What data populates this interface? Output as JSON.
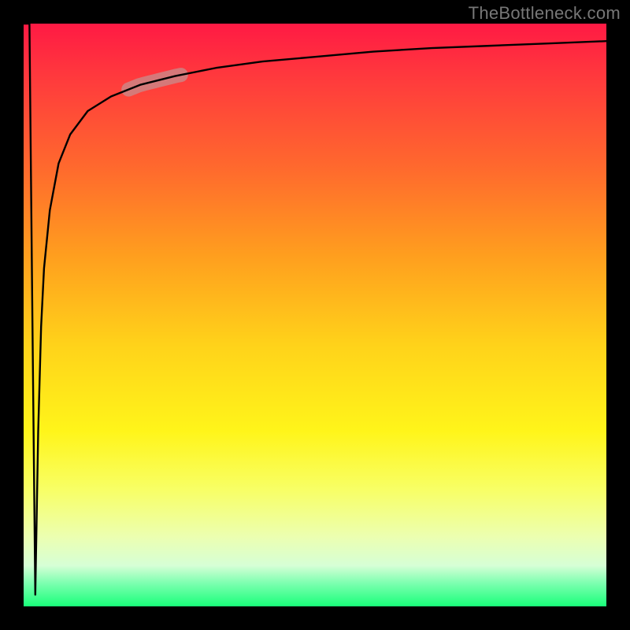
{
  "watermark": "TheBottleneck.com",
  "chart_data": {
    "type": "line",
    "title": "",
    "xlabel": "",
    "ylabel": "",
    "ylim": [
      0,
      100
    ],
    "x": [
      0.0,
      0.01,
      0.015,
      0.02,
      0.025,
      0.03,
      0.035,
      0.045,
      0.06,
      0.08,
      0.11,
      0.15,
      0.2,
      0.26,
      0.33,
      0.41,
      0.5,
      0.6,
      0.7,
      0.8,
      0.9,
      1.0
    ],
    "values": [
      100,
      100,
      50,
      2,
      30,
      48,
      58,
      68,
      76,
      81,
      85,
      87.5,
      89.5,
      91,
      92.4,
      93.5,
      94.3,
      95.2,
      95.8,
      96.2,
      96.6,
      97.0
    ],
    "highlight_range_x": [
      0.18,
      0.27
    ],
    "background_gradient": [
      "#ff1a44",
      "#ff6a2d",
      "#ffd21a",
      "#fff51a",
      "#19ff7a"
    ],
    "note": "x is normalized 0–1 across the plot width; values are percent of plot height from bottom; curve drops sharply near x≈0.02 then rises asymptotically toward ~97%."
  }
}
